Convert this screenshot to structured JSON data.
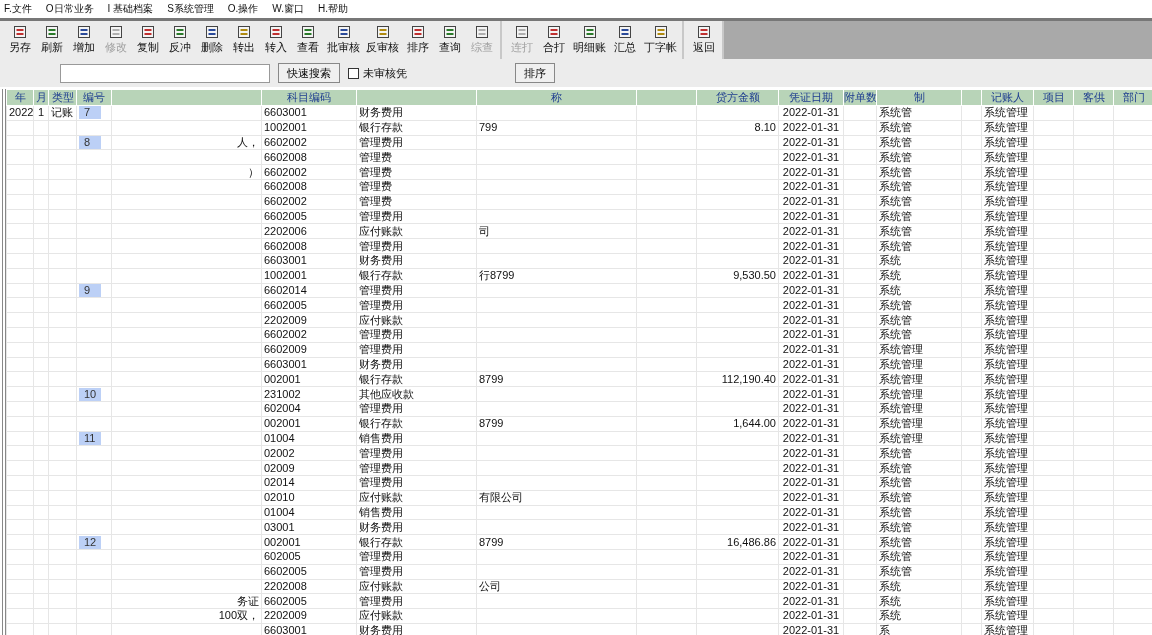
{
  "menu": [
    "F.文件",
    "O日常业务",
    "I 基础档案",
    "S系统管理",
    "O.操作",
    "W.窗口",
    "H.帮助"
  ],
  "toolbar": {
    "groups": [
      [
        {
          "label": "另存",
          "disabled": false
        },
        {
          "label": "刷新",
          "disabled": false
        },
        {
          "label": "增加",
          "disabled": false
        },
        {
          "label": "修改",
          "disabled": true
        },
        {
          "label": "复制",
          "disabled": false
        },
        {
          "label": "反冲",
          "disabled": false
        },
        {
          "label": "删除",
          "disabled": false
        },
        {
          "label": "转出",
          "disabled": false
        },
        {
          "label": "转入",
          "disabled": false
        },
        {
          "label": "查看",
          "disabled": false
        },
        {
          "label": "批审核",
          "disabled": false
        },
        {
          "label": "反审核",
          "disabled": false
        },
        {
          "label": "排序",
          "disabled": false
        },
        {
          "label": "查询",
          "disabled": false
        },
        {
          "label": "综查",
          "disabled": true
        }
      ],
      [
        {
          "label": "连打",
          "disabled": true
        },
        {
          "label": "合打",
          "disabled": false
        },
        {
          "label": "明细账",
          "disabled": false
        },
        {
          "label": "汇总",
          "disabled": false
        },
        {
          "label": "丁字帐",
          "disabled": false
        }
      ],
      [
        {
          "label": "返回",
          "disabled": false
        }
      ]
    ]
  },
  "search": {
    "search_button": "快速搜索",
    "unreviewed_only": {
      "label": "未审核凭",
      "checked": false
    },
    "sort_button": "排序"
  },
  "table": {
    "header": {
      "year": "年",
      "month": "月",
      "type": "类型",
      "number": "编号",
      "account_code": "科目编码",
      "auxiliary": "称",
      "credit": "贷方金额",
      "date": "凭证日期",
      "attachments": "附单数",
      "maker": "制",
      "bookkeeper": "记账人",
      "project": "项目",
      "supplier": "客供",
      "department": "部门"
    },
    "rows": [
      {
        "year": "2022",
        "month": "1",
        "type": "记账",
        "number": "7",
        "account_code": "6603001",
        "account_name": "财务费用",
        "date": "2022-01-31",
        "maker": "系统管",
        "bookkeeper": "系统管理"
      },
      {
        "account_code": "1002001",
        "account_name": "银行存款",
        "auxiliary": "799",
        "credit": "8.10",
        "date": "2022-01-31",
        "maker": "系统管",
        "bookkeeper": "系统管理"
      },
      {
        "number": "8",
        "summary": "人，",
        "account_code": "6602002",
        "account_name": "管理费用",
        "date": "2022-01-31",
        "maker": "系统管",
        "bookkeeper": "系统管理"
      },
      {
        "account_code": "6602008",
        "account_name": "管理费",
        "date": "2022-01-31",
        "maker": "系统管",
        "bookkeeper": "系统管理"
      },
      {
        "summary": "）",
        "account_code": "6602002",
        "account_name": "管理费",
        "date": "2022-01-31",
        "maker": "系统管",
        "bookkeeper": "系统管理"
      },
      {
        "account_code": "6602008",
        "account_name": "管理费",
        "date": "2022-01-31",
        "maker": "系统管",
        "bookkeeper": "系统管理"
      },
      {
        "account_code": "6602002",
        "account_name": "管理费",
        "date": "2022-01-31",
        "maker": "系统管",
        "bookkeeper": "系统管理"
      },
      {
        "account_code": "6602005",
        "account_name": "管理费用",
        "date": "2022-01-31",
        "maker": "系统管",
        "bookkeeper": "系统管理"
      },
      {
        "account_code": "2202006",
        "account_name": "应付账款",
        "auxiliary": "司",
        "date": "2022-01-31",
        "maker": "系统管",
        "bookkeeper": "系统管理"
      },
      {
        "account_code": "6602008",
        "account_name": "管理费用",
        "date": "2022-01-31",
        "maker": "系统管",
        "bookkeeper": "系统管理"
      },
      {
        "account_code": "6603001",
        "account_name": "财务费用",
        "date": "2022-01-31",
        "maker": "系统",
        "bookkeeper": "系统管理"
      },
      {
        "account_code": "1002001",
        "account_name": "银行存款",
        "auxiliary": "行8799",
        "credit": "9,530.50",
        "date": "2022-01-31",
        "maker": "系统",
        "bookkeeper": "系统管理"
      },
      {
        "number": "9",
        "account_code": "6602014",
        "account_name": "管理费用",
        "date": "2022-01-31",
        "maker": "系统",
        "bookkeeper": "系统管理"
      },
      {
        "account_code": "6602005",
        "account_name": "管理费用",
        "date": "2022-01-31",
        "maker": "系统管",
        "bookkeeper": "系统管理"
      },
      {
        "account_code": "2202009",
        "account_name": "应付账款",
        "date": "2022-01-31",
        "maker": "系统管",
        "bookkeeper": "系统管理"
      },
      {
        "account_code": "6602002",
        "account_name": "管理费用",
        "date": "2022-01-31",
        "maker": "系统管",
        "bookkeeper": "系统管理"
      },
      {
        "account_code": "6602009",
        "account_name": "管理费用",
        "date": "2022-01-31",
        "maker": "系统管理",
        "bookkeeper": "系统管理"
      },
      {
        "account_code": "6603001",
        "account_name": "财务费用",
        "date": "2022-01-31",
        "maker": "系统管理",
        "bookkeeper": "系统管理"
      },
      {
        "account_code": "002001",
        "account_name": "银行存款",
        "auxiliary": "8799",
        "credit": "112,190.40",
        "date": "2022-01-31",
        "maker": "系统管理",
        "bookkeeper": "系统管理"
      },
      {
        "number": "10",
        "account_code": "231002",
        "account_name": "其他应收款",
        "date": "2022-01-31",
        "maker": "系统管理",
        "bookkeeper": "系统管理"
      },
      {
        "account_code": "602004",
        "account_name": "管理费用",
        "date": "2022-01-31",
        "maker": "系统管理",
        "bookkeeper": "系统管理"
      },
      {
        "account_code": "002001",
        "account_name": "银行存款",
        "auxiliary": "8799",
        "credit": "1,644.00",
        "date": "2022-01-31",
        "maker": "系统管理",
        "bookkeeper": "系统管理"
      },
      {
        "number": "11",
        "account_code": "01004",
        "account_name": "销售费用",
        "date": "2022-01-31",
        "maker": "系统管理",
        "bookkeeper": "系统管理"
      },
      {
        "account_code": "02002",
        "account_name": "管理费用",
        "date": "2022-01-31",
        "maker": "系统管",
        "bookkeeper": "系统管理"
      },
      {
        "account_code": "02009",
        "account_name": "管理费用",
        "date": "2022-01-31",
        "maker": "系统管",
        "bookkeeper": "系统管理"
      },
      {
        "account_code": "02014",
        "account_name": "管理费用",
        "date": "2022-01-31",
        "maker": "系统管",
        "bookkeeper": "系统管理"
      },
      {
        "account_code": "02010",
        "account_name": "应付账款",
        "auxiliary": "有限公司",
        "date": "2022-01-31",
        "maker": "系统管",
        "bookkeeper": "系统管理"
      },
      {
        "account_code": "01004",
        "account_name": "销售费用",
        "date": "2022-01-31",
        "maker": "系统管",
        "bookkeeper": "系统管理"
      },
      {
        "account_code": "03001",
        "account_name": "财务费用",
        "date": "2022-01-31",
        "maker": "系统管",
        "bookkeeper": "系统管理"
      },
      {
        "number": "12",
        "account_code": "002001",
        "account_name": "银行存款",
        "auxiliary": "8799",
        "credit": "16,486.86",
        "date": "2022-01-31",
        "maker": "系统管",
        "bookkeeper": "系统管理"
      },
      {
        "account_code": "602005",
        "account_name": "管理费用",
        "date": "2022-01-31",
        "maker": "系统管",
        "bookkeeper": "系统管理"
      },
      {
        "account_code": "6602005",
        "account_name": "管理费用",
        "date": "2022-01-31",
        "maker": "系统管",
        "bookkeeper": "系统管理"
      },
      {
        "account_code": "2202008",
        "account_name": "应付账款",
        "auxiliary": "公司",
        "date": "2022-01-31",
        "maker": "系统",
        "bookkeeper": "系统管理"
      },
      {
        "summary": "务证",
        "account_code": "6602005",
        "account_name": "管理费用",
        "date": "2022-01-31",
        "maker": "系统",
        "bookkeeper": "系统管理"
      },
      {
        "summary": "100双，",
        "account_code": "2202009",
        "account_name": "应付账款",
        "date": "2022-01-31",
        "maker": "系统",
        "bookkeeper": "系统管理"
      },
      {
        "account_code": "6603001",
        "account_name": "财务费用",
        "date": "2022-01-31",
        "maker": "系",
        "bookkeeper": "系统管理"
      }
    ]
  }
}
